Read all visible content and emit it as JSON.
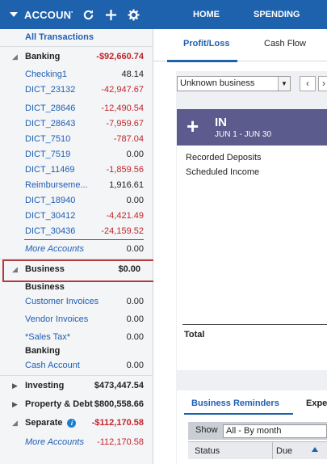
{
  "header": {
    "title": "ACCOUNT",
    "refresh_icon": "refresh-icon",
    "add_icon": "add-icon",
    "settings_icon": "gear-icon"
  },
  "nav": {
    "home": "HOME",
    "spending": "SPENDING"
  },
  "colors": {
    "brand_blue": "#1e62ad",
    "negative_red": "#c0262d",
    "link_blue": "#1e5fb4",
    "panel_purple": "#5b5b8e"
  },
  "sidebar": {
    "all_transactions": "All Transactions",
    "banking": {
      "label": "Banking",
      "total": "-$92,660.74",
      "accounts": [
        {
          "name": "Checking1",
          "value": "48.14",
          "negative": false
        },
        {
          "name": "DICT_23132",
          "value": "-42,947.67",
          "negative": true
        },
        {
          "name": "DICT_28646",
          "value": "-12,490.54",
          "negative": true
        },
        {
          "name": "DICT_28643",
          "value": "-7,959.67",
          "negative": true
        },
        {
          "name": "DICT_7510",
          "value": "-787.04",
          "negative": true
        },
        {
          "name": "DICT_7519",
          "value": "0.00",
          "negative": false
        },
        {
          "name": "DICT_11469",
          "value": "-1,859.56",
          "negative": true
        },
        {
          "name": "Reimburseme...",
          "value": "1,916.61",
          "negative": false
        },
        {
          "name": "DICT_18940",
          "value": "0.00",
          "negative": false
        },
        {
          "name": "DICT_30412",
          "value": "-4,421.49",
          "negative": true
        },
        {
          "name": "DICT_30436",
          "value": "-24,159.52",
          "negative": true
        }
      ],
      "more": "More Accounts",
      "more_value": "0.00"
    },
    "business": {
      "label": "Business",
      "total": "$0.00",
      "sub_business": "Business",
      "items": [
        {
          "name": "Customer Invoices",
          "value": "0.00"
        },
        {
          "name": "Vendor Invoices",
          "value": "0.00"
        },
        {
          "name": "*Sales Tax*",
          "value": "0.00"
        }
      ],
      "sub_banking": "Banking",
      "cash": {
        "name": "Cash Account",
        "value": "0.00"
      }
    },
    "investing": {
      "label": "Investing",
      "total": "$473,447.54"
    },
    "property": {
      "label": "Property & Debt",
      "total": "$800,558.66"
    },
    "separate": {
      "label": "Separate",
      "total": "-$112,170.58",
      "info_icon": "info-icon"
    },
    "more_accounts": {
      "label": "More Accounts",
      "value": "-112,170.58"
    }
  },
  "main": {
    "tabs": [
      "Profit/Loss",
      "Cash Flow"
    ],
    "filter_value": "Unknown business",
    "prev_icon": "chevron-left-icon",
    "next_icon": "chevron-right-icon",
    "in_panel": {
      "title": "IN",
      "range": "JUN 1 - JUN 30",
      "icon": "plus-icon"
    },
    "lines": [
      "Recorded Deposits",
      "Scheduled Income"
    ],
    "total": "Total",
    "reminders": {
      "tab1": "Business Reminders",
      "tab2": "Expe",
      "show_label": "Show",
      "show_value": "All - By month",
      "col_status": "Status",
      "col_due": "Due"
    }
  }
}
